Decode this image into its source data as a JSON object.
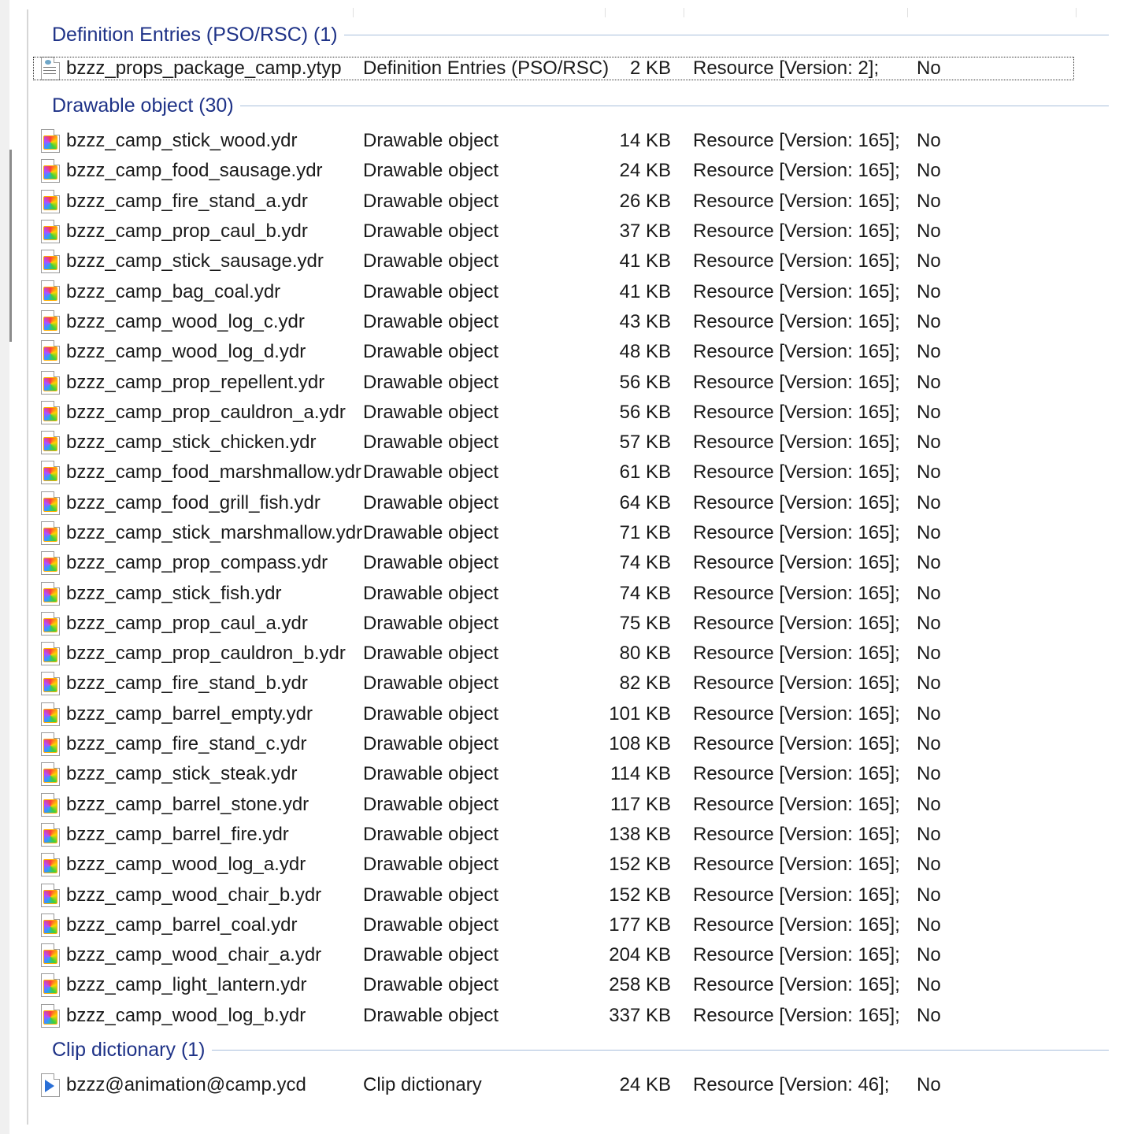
{
  "groups": [
    {
      "title": "Definition Entries (PSO/RSC) (1)",
      "icon": "ytyp-file-icon",
      "rows": [
        {
          "name": "bzzz_props_package_camp.ytyp",
          "type": "Definition Entries (PSO/RSC)",
          "size": "2 KB",
          "attributes": "Resource [Version: 2];",
          "encrypted": "No"
        }
      ]
    },
    {
      "title": "Drawable object (30)",
      "icon": "ydr-file-icon",
      "rows": [
        {
          "name": "bzzz_camp_stick_wood.ydr",
          "type": "Drawable object",
          "size": "14 KB",
          "attributes": "Resource [Version: 165];",
          "encrypted": "No"
        },
        {
          "name": "bzzz_camp_food_sausage.ydr",
          "type": "Drawable object",
          "size": "24 KB",
          "attributes": "Resource [Version: 165];",
          "encrypted": "No"
        },
        {
          "name": "bzzz_camp_fire_stand_a.ydr",
          "type": "Drawable object",
          "size": "26 KB",
          "attributes": "Resource [Version: 165];",
          "encrypted": "No"
        },
        {
          "name": "bzzz_camp_prop_caul_b.ydr",
          "type": "Drawable object",
          "size": "37 KB",
          "attributes": "Resource [Version: 165];",
          "encrypted": "No"
        },
        {
          "name": "bzzz_camp_stick_sausage.ydr",
          "type": "Drawable object",
          "size": "41 KB",
          "attributes": "Resource [Version: 165];",
          "encrypted": "No"
        },
        {
          "name": "bzzz_camp_bag_coal.ydr",
          "type": "Drawable object",
          "size": "41 KB",
          "attributes": "Resource [Version: 165];",
          "encrypted": "No"
        },
        {
          "name": "bzzz_camp_wood_log_c.ydr",
          "type": "Drawable object",
          "size": "43 KB",
          "attributes": "Resource [Version: 165];",
          "encrypted": "No"
        },
        {
          "name": "bzzz_camp_wood_log_d.ydr",
          "type": "Drawable object",
          "size": "48 KB",
          "attributes": "Resource [Version: 165];",
          "encrypted": "No"
        },
        {
          "name": "bzzz_camp_prop_repellent.ydr",
          "type": "Drawable object",
          "size": "56 KB",
          "attributes": "Resource [Version: 165];",
          "encrypted": "No"
        },
        {
          "name": "bzzz_camp_prop_cauldron_a.ydr",
          "type": "Drawable object",
          "size": "56 KB",
          "attributes": "Resource [Version: 165];",
          "encrypted": "No"
        },
        {
          "name": "bzzz_camp_stick_chicken.ydr",
          "type": "Drawable object",
          "size": "57 KB",
          "attributes": "Resource [Version: 165];",
          "encrypted": "No"
        },
        {
          "name": "bzzz_camp_food_marshmallow.ydr",
          "type": "Drawable object",
          "size": "61 KB",
          "attributes": "Resource [Version: 165];",
          "encrypted": "No"
        },
        {
          "name": "bzzz_camp_food_grill_fish.ydr",
          "type": "Drawable object",
          "size": "64 KB",
          "attributes": "Resource [Version: 165];",
          "encrypted": "No"
        },
        {
          "name": "bzzz_camp_stick_marshmallow.ydr",
          "type": "Drawable object",
          "size": "71 KB",
          "attributes": "Resource [Version: 165];",
          "encrypted": "No"
        },
        {
          "name": "bzzz_camp_prop_compass.ydr",
          "type": "Drawable object",
          "size": "74 KB",
          "attributes": "Resource [Version: 165];",
          "encrypted": "No"
        },
        {
          "name": "bzzz_camp_stick_fish.ydr",
          "type": "Drawable object",
          "size": "74 KB",
          "attributes": "Resource [Version: 165];",
          "encrypted": "No"
        },
        {
          "name": "bzzz_camp_prop_caul_a.ydr",
          "type": "Drawable object",
          "size": "75 KB",
          "attributes": "Resource [Version: 165];",
          "encrypted": "No"
        },
        {
          "name": "bzzz_camp_prop_cauldron_b.ydr",
          "type": "Drawable object",
          "size": "80 KB",
          "attributes": "Resource [Version: 165];",
          "encrypted": "No"
        },
        {
          "name": "bzzz_camp_fire_stand_b.ydr",
          "type": "Drawable object",
          "size": "82 KB",
          "attributes": "Resource [Version: 165];",
          "encrypted": "No"
        },
        {
          "name": "bzzz_camp_barrel_empty.ydr",
          "type": "Drawable object",
          "size": "101 KB",
          "attributes": "Resource [Version: 165];",
          "encrypted": "No"
        },
        {
          "name": "bzzz_camp_fire_stand_c.ydr",
          "type": "Drawable object",
          "size": "108 KB",
          "attributes": "Resource [Version: 165];",
          "encrypted": "No"
        },
        {
          "name": "bzzz_camp_stick_steak.ydr",
          "type": "Drawable object",
          "size": "114 KB",
          "attributes": "Resource [Version: 165];",
          "encrypted": "No"
        },
        {
          "name": "bzzz_camp_barrel_stone.ydr",
          "type": "Drawable object",
          "size": "117 KB",
          "attributes": "Resource [Version: 165];",
          "encrypted": "No"
        },
        {
          "name": "bzzz_camp_barrel_fire.ydr",
          "type": "Drawable object",
          "size": "138 KB",
          "attributes": "Resource [Version: 165];",
          "encrypted": "No"
        },
        {
          "name": "bzzz_camp_wood_log_a.ydr",
          "type": "Drawable object",
          "size": "152 KB",
          "attributes": "Resource [Version: 165];",
          "encrypted": "No"
        },
        {
          "name": "bzzz_camp_wood_chair_b.ydr",
          "type": "Drawable object",
          "size": "152 KB",
          "attributes": "Resource [Version: 165];",
          "encrypted": "No"
        },
        {
          "name": "bzzz_camp_barrel_coal.ydr",
          "type": "Drawable object",
          "size": "177 KB",
          "attributes": "Resource [Version: 165];",
          "encrypted": "No"
        },
        {
          "name": "bzzz_camp_wood_chair_a.ydr",
          "type": "Drawable object",
          "size": "204 KB",
          "attributes": "Resource [Version: 165];",
          "encrypted": "No"
        },
        {
          "name": "bzzz_camp_light_lantern.ydr",
          "type": "Drawable object",
          "size": "258 KB",
          "attributes": "Resource [Version: 165];",
          "encrypted": "No"
        },
        {
          "name": "bzzz_camp_wood_log_b.ydr",
          "type": "Drawable object",
          "size": "337 KB",
          "attributes": "Resource [Version: 165];",
          "encrypted": "No"
        }
      ]
    },
    {
      "title": "Clip dictionary (1)",
      "icon": "ycd-file-icon",
      "rows": [
        {
          "name": "bzzz@animation@camp.ycd",
          "type": "Clip dictionary",
          "size": "24 KB",
          "attributes": "Resource [Version: 46];",
          "encrypted": "No"
        }
      ]
    }
  ],
  "colors": {
    "group_header": "#1e3287",
    "group_line": "#a7bedb"
  }
}
